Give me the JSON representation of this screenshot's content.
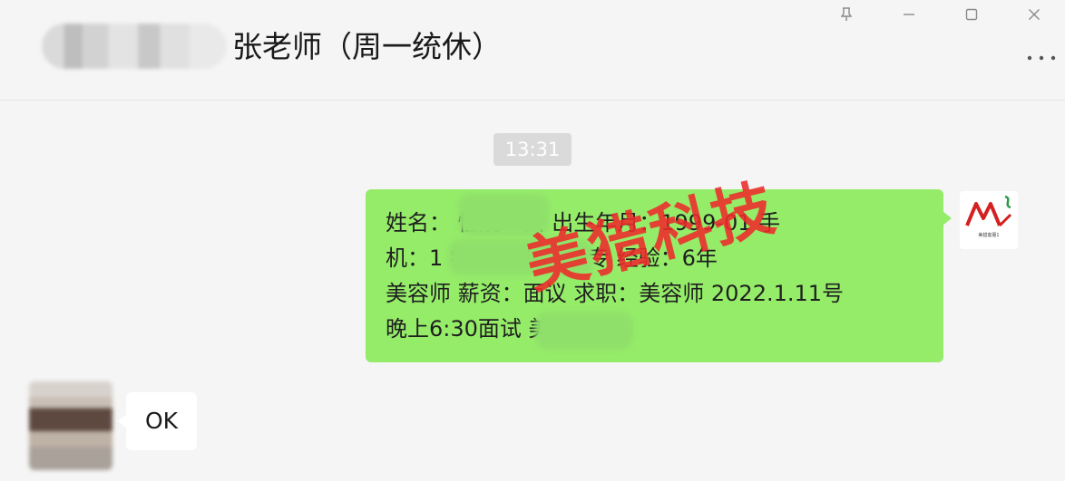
{
  "header": {
    "title": "张老师（周一统休）"
  },
  "window_controls": {
    "pin_icon": "pin-icon",
    "minimize_icon": "minimize-icon",
    "maximize_icon": "maximize-icon",
    "close_icon": "close-icon",
    "more_icon": "more-icon"
  },
  "messages": {
    "timestamp": "13:31",
    "outgoing": {
      "lines": [
        "姓名：        性别：女 出生年月：1999-01 手",
        "机：1                学历：高中/中专 经验：6年",
        "美容师 薪资：面议 求职：美容师 2022.1.11号",
        "晚上6:30面试                 美容师"
      ],
      "avatar_logo_text": "美猎客服1",
      "watermark": "美猎科技"
    },
    "incoming": {
      "text": "OK"
    }
  },
  "colors": {
    "outgoing_bubble": "#95ec69",
    "incoming_bubble": "#ffffff",
    "background": "#f5f5f5",
    "watermark": "#ee2b2b"
  }
}
